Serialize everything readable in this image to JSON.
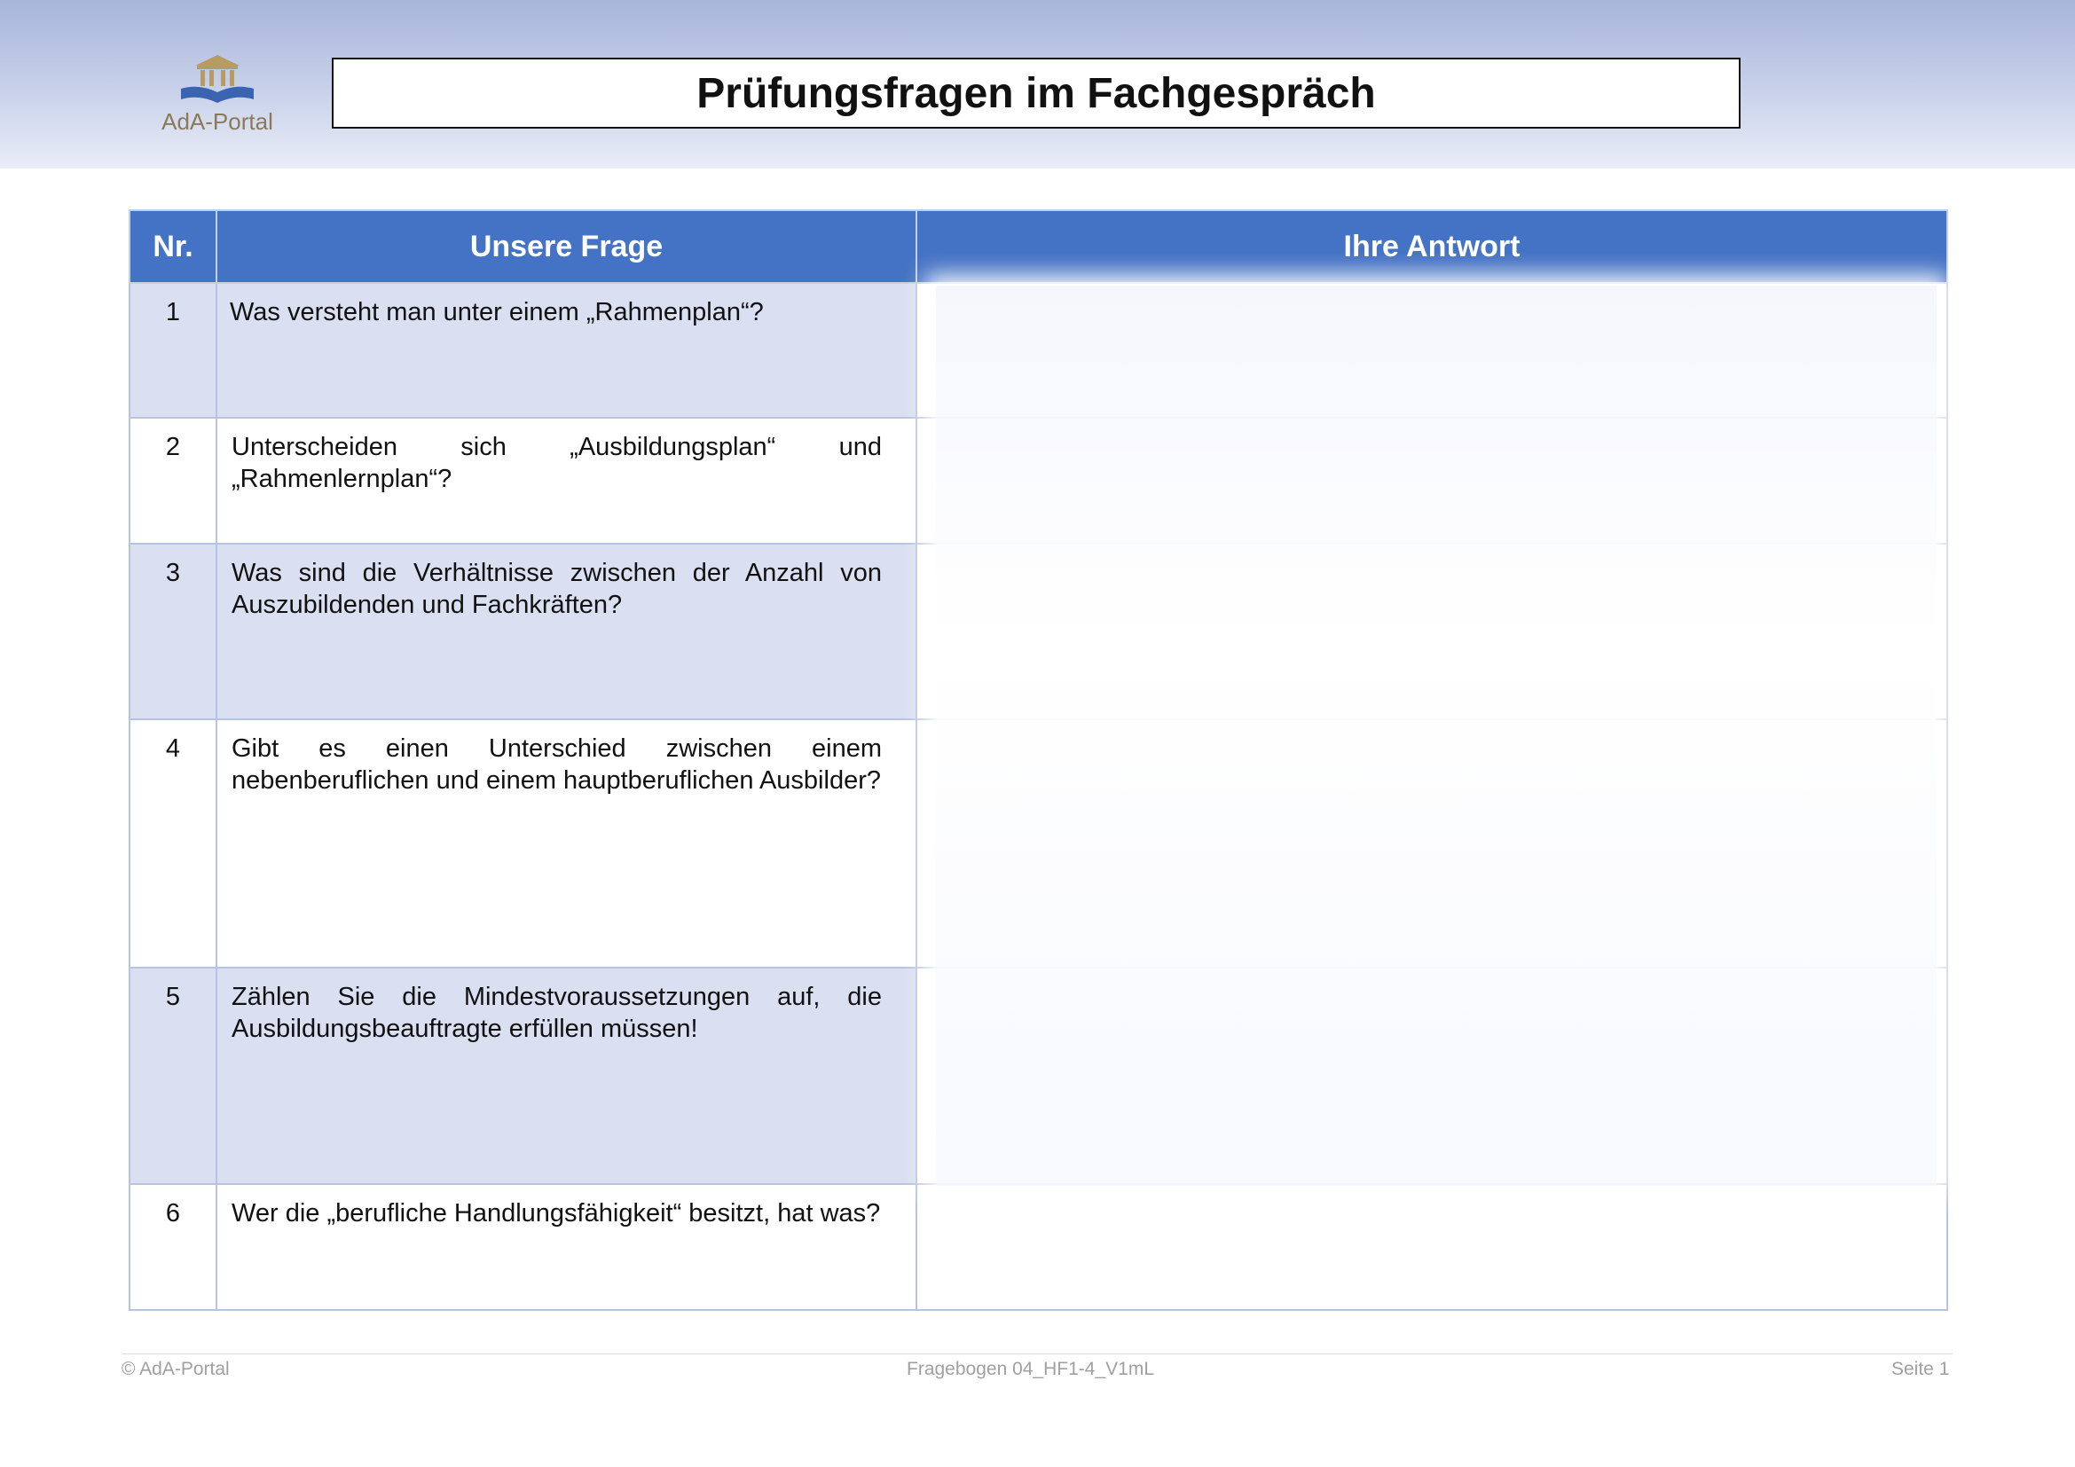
{
  "header": {
    "logo_text": "AdA-Portal",
    "title": "Prüfungsfragen im Fachgespräch"
  },
  "table": {
    "columns": [
      "Nr.",
      "Unsere Frage",
      "Ihre Antwort"
    ],
    "rows": [
      {
        "nr": "1",
        "question": "Was versteht man unter einem „Rahmenplan“?",
        "answer": ""
      },
      {
        "nr": "2",
        "question": "Unterscheiden sich „Ausbildungsplan“ und „Rahmenlernplan“?",
        "answer": ""
      },
      {
        "nr": "3",
        "question": "Was sind die Verhältnisse zwischen der Anzahl von Auszubildenden und Fachkräften?",
        "answer": ""
      },
      {
        "nr": "4",
        "question": "Gibt es einen Unterschied zwischen einem nebenberuflichen und einem hauptberuflichen Ausbilder?",
        "answer": ""
      },
      {
        "nr": "5",
        "question": "Zählen Sie die Mindestvoraussetzungen auf, die Ausbildungsbeauftragte erfüllen müssen!",
        "answer": ""
      },
      {
        "nr": "6",
        "question": "Wer die „berufliche Handlungsfähigkeit“ besitzt, hat was?",
        "answer": ""
      }
    ]
  },
  "footer": {
    "copyright": "© AdA-Portal",
    "doc_id": "Fragebogen 04_HF1-4_V1mL",
    "page": "Seite 1"
  },
  "colors": {
    "header_band": "#b0bde0",
    "table_header": "#4472c4",
    "row_shade": "#dae0f2",
    "border": "#b4c4e2"
  }
}
